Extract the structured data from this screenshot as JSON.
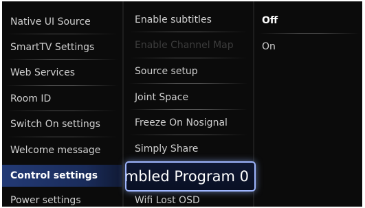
{
  "menu_level1": {
    "items": [
      {
        "label": "Native UI Source"
      },
      {
        "label": "SmartTV Settings"
      },
      {
        "label": "Web Services"
      },
      {
        "label": "Room ID"
      },
      {
        "label": "Switch On settings"
      },
      {
        "label": "Welcome message"
      },
      {
        "label": "Control settings"
      },
      {
        "label": "Power settings"
      }
    ]
  },
  "menu_level2": {
    "items": [
      {
        "label": "Enable subtitles"
      },
      {
        "label": "Enable Channel Map"
      },
      {
        "label": "Source setup"
      },
      {
        "label": "Joint Space"
      },
      {
        "label": "Freeze On Nosignal"
      },
      {
        "label": "Simply Share"
      },
      {
        "label": "ımbled Program 0"
      },
      {
        "label": "Wifi Lost OSD"
      }
    ]
  },
  "menu_level3": {
    "options": [
      {
        "label": "Off"
      },
      {
        "label": "On"
      }
    ]
  },
  "colors": {
    "background": "#0b0b0b",
    "highlight": "#233a75",
    "focus_border": "#9fb6ff",
    "disabled_text": "#3c3c3c"
  }
}
